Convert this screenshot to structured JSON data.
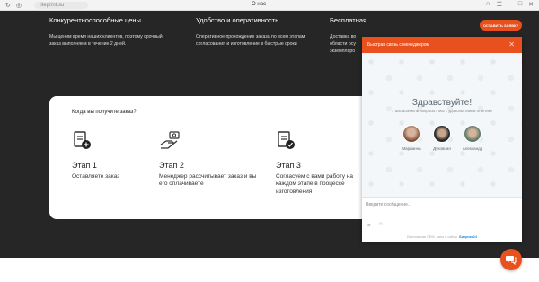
{
  "browser": {
    "url": "liteprint.su",
    "title": "О нас"
  },
  "features": [
    {
      "title": "Конкурентноспособные цены",
      "text": "Мы ценим время наших клиентов, поэтому срочный заказ выполняем в течение 2 дней."
    },
    {
      "title": "Удобство и оперативность",
      "text": "Оперативное прохождение заказа по всем этапам согласования и изготовление в быстрые сроки"
    },
    {
      "title": "Бесплатная доставка",
      "text": "Доставка во области осу экземпляро"
    }
  ],
  "order_button": "ОСТАВИТЬ ЗАЯВКУ",
  "steps_card": {
    "title": "Когда вы получите заказ?",
    "steps": [
      {
        "title": "Этап 1",
        "text": "Оставляете заказ"
      },
      {
        "title": "Этап 2",
        "text": "Менеджер рассчитывает заказ и вы его оплачиваете"
      },
      {
        "title": "Этап 3",
        "text": "Согласуем с вами работу на каждом этапе в процессе изготовления"
      }
    ]
  },
  "chat": {
    "header": "Быстрая связь с менеджером",
    "greeting": "Здравствуйте!",
    "subtitle": "У вас возникли вопросы? Мы с удовольствием ответим!",
    "managers": [
      "Марианна",
      "Дуковная",
      "Александр"
    ],
    "input_placeholder": "Введите сообщение...",
    "footer_prefix": "Бесплатная CRM, чаты и сайты.",
    "footer_brand": "Битрикс24",
    "colors": {
      "accent": "#e8501d"
    }
  },
  "icons": [
    "back-icon",
    "forward-icon",
    "reload-icon",
    "close-icon",
    "chat-bubbles-icon",
    "paperclip-icon",
    "smiley-icon"
  ]
}
